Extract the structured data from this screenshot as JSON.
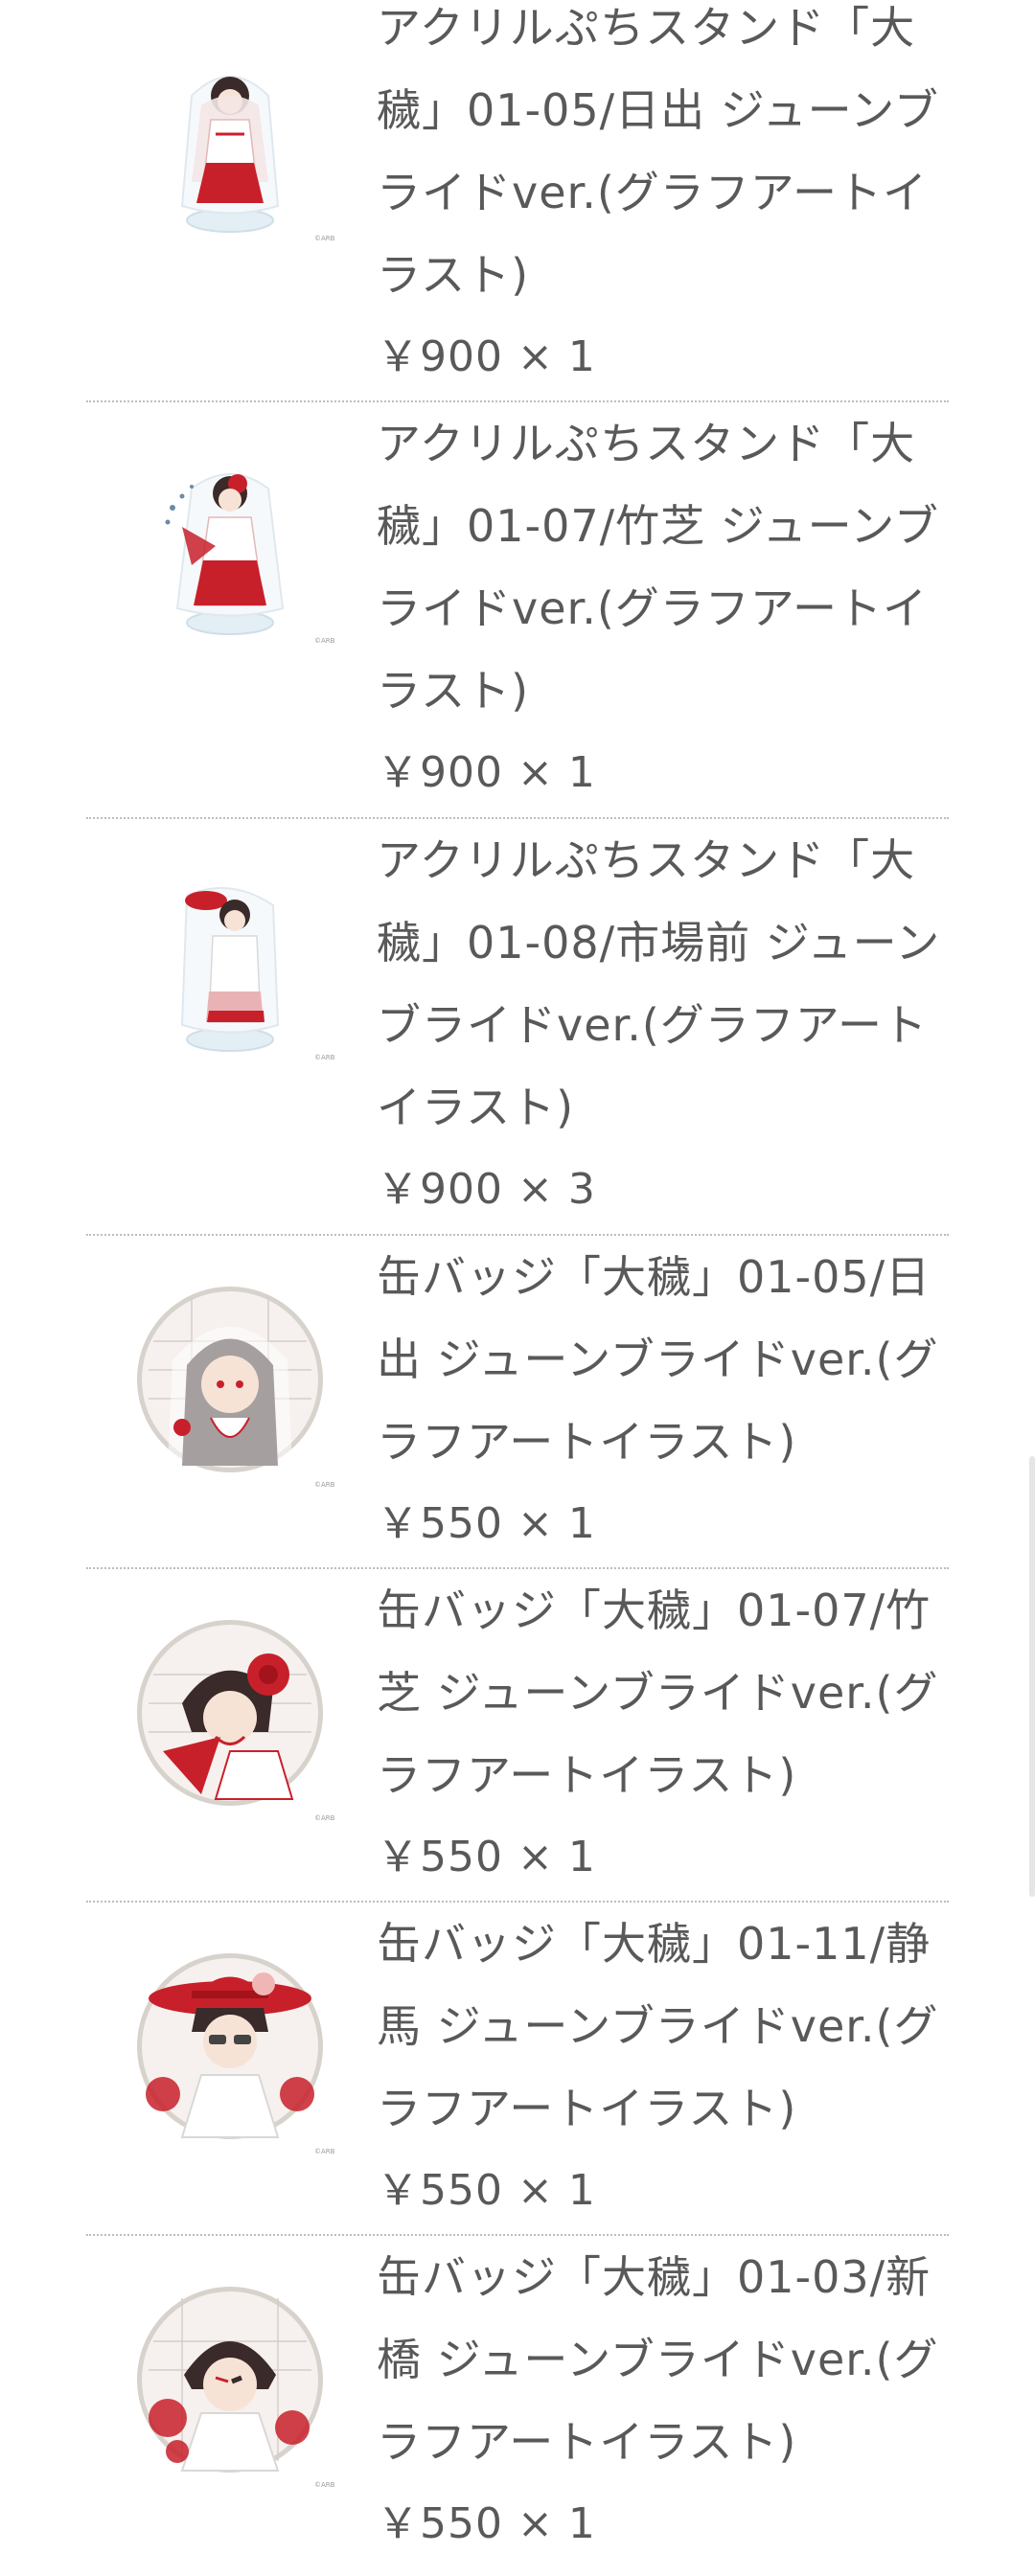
{
  "items": [
    {
      "name": "アクリルぷちスタンド「大穢」01-05/日出 ジューンブライドver.(グラフアートイラスト)",
      "price": "￥900 × 1",
      "image": "acrylic-stand-hinode-icon",
      "credit": "©ARB"
    },
    {
      "name": "アクリルぷちスタンド「大穢」01-07/竹芝 ジューンブライドver.(グラフアートイラスト)",
      "price": "￥900 × 1",
      "image": "acrylic-stand-takeshiba-icon",
      "credit": "©ARB"
    },
    {
      "name": "アクリルぷちスタンド「大穢」01-08/市場前 ジューンブライドver.(グラフアートイラスト)",
      "price": "￥900 × 3",
      "image": "acrylic-stand-shijomae-icon",
      "credit": "©ARB"
    },
    {
      "name": "缶バッジ「大穢」01-05/日出 ジューンブライドver.(グラフアートイラスト)",
      "price": "￥550 × 1",
      "image": "can-badge-hinode-icon",
      "credit": "©ARB"
    },
    {
      "name": "缶バッジ「大穢」01-07/竹芝 ジューンブライドver.(グラフアートイラスト)",
      "price": "￥550 × 1",
      "image": "can-badge-takeshiba-icon",
      "credit": "©ARB"
    },
    {
      "name": "缶バッジ「大穢」01-11/静馬 ジューンブライドver.(グラフアートイラスト)",
      "price": "￥550 × 1",
      "image": "can-badge-shizuma-icon",
      "credit": "©ARB"
    },
    {
      "name": "缶バッジ「大穢」01-03/新橋 ジューンブライドver.(グラフアートイラスト)",
      "price": "￥550 × 1",
      "image": "can-badge-shinbashi-icon",
      "credit": "©ARB"
    }
  ],
  "colors": {
    "text": "#595959",
    "divider": "#bdbdbd",
    "accent_red": "#c8202a"
  }
}
